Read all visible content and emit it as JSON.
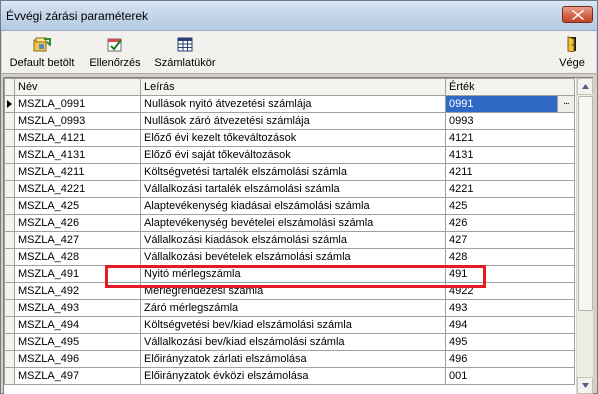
{
  "window": {
    "title": "Évvégi zárási paraméterek"
  },
  "toolbar": {
    "buttons": [
      {
        "label": "Default  betölt",
        "icon": "load-defaults-icon"
      },
      {
        "label": "Ellenőrzés",
        "icon": "check-icon"
      },
      {
        "label": "Számlatükör",
        "icon": "chart-of-accounts-icon"
      },
      {
        "label": "Vége",
        "icon": "exit-door-icon"
      }
    ]
  },
  "grid": {
    "columns": [
      "Név",
      "Leírás",
      "Érték"
    ],
    "rows": [
      {
        "nev": "MSZLA_0991",
        "leiras": "Nullások nyitó átvezetési számlája",
        "ertek": "0991"
      },
      {
        "nev": "MSZLA_0993",
        "leiras": "Nullások záró  átvezetési számlája",
        "ertek": "0993"
      },
      {
        "nev": "MSZLA_4121",
        "leiras": "Előző évi kezelt tőkeváltozások",
        "ertek": "4121"
      },
      {
        "nev": "MSZLA_4131",
        "leiras": "Előző évi saját tőkeváltozások",
        "ertek": "4131"
      },
      {
        "nev": "MSZLA_4211",
        "leiras": "Költségvetési tartalék elszámolási számla",
        "ertek": "4211"
      },
      {
        "nev": "MSZLA_4221",
        "leiras": "Vállalkozási tartalék elszámolási számla",
        "ertek": "4221"
      },
      {
        "nev": "MSZLA_425",
        "leiras": "Alaptevékenység kiadásai elszámolási számla",
        "ertek": "425"
      },
      {
        "nev": "MSZLA_426",
        "leiras": "Alaptevékenység bevételei elszámolási számla",
        "ertek": "426"
      },
      {
        "nev": "MSZLA_427",
        "leiras": "Vállalkozási kiadások elszámolási számla",
        "ertek": "427"
      },
      {
        "nev": "MSZLA_428",
        "leiras": "Vállalkozási bevételek elszámolási számla",
        "ertek": "428"
      },
      {
        "nev": "MSZLA_491",
        "leiras": "Nyitó mérlegszámla",
        "ertek": "491"
      },
      {
        "nev": "MSZLA_492",
        "leiras": "Mérlegrendezési számla",
        "ertek": "4922"
      },
      {
        "nev": "MSZLA_493",
        "leiras": "Záró mérlegszámla",
        "ertek": "493"
      },
      {
        "nev": "MSZLA_494",
        "leiras": "Költségvetési bev/kiad elszámolási számla",
        "ertek": "494"
      },
      {
        "nev": "MSZLA_495",
        "leiras": "Vállalkozási bev/kiad elszámolási számla",
        "ertek": "495"
      },
      {
        "nev": "MSZLA_496",
        "leiras": "Előirányzatok zárlati elszámolása",
        "ertek": "496"
      },
      {
        "nev": "MSZLA_497",
        "leiras": "Előirányzatok évközi  elszámolása",
        "ertek": "001"
      }
    ],
    "ellipsis": "..."
  },
  "colors": {
    "selection": "#3169c6",
    "highlight": "#e51b24"
  }
}
